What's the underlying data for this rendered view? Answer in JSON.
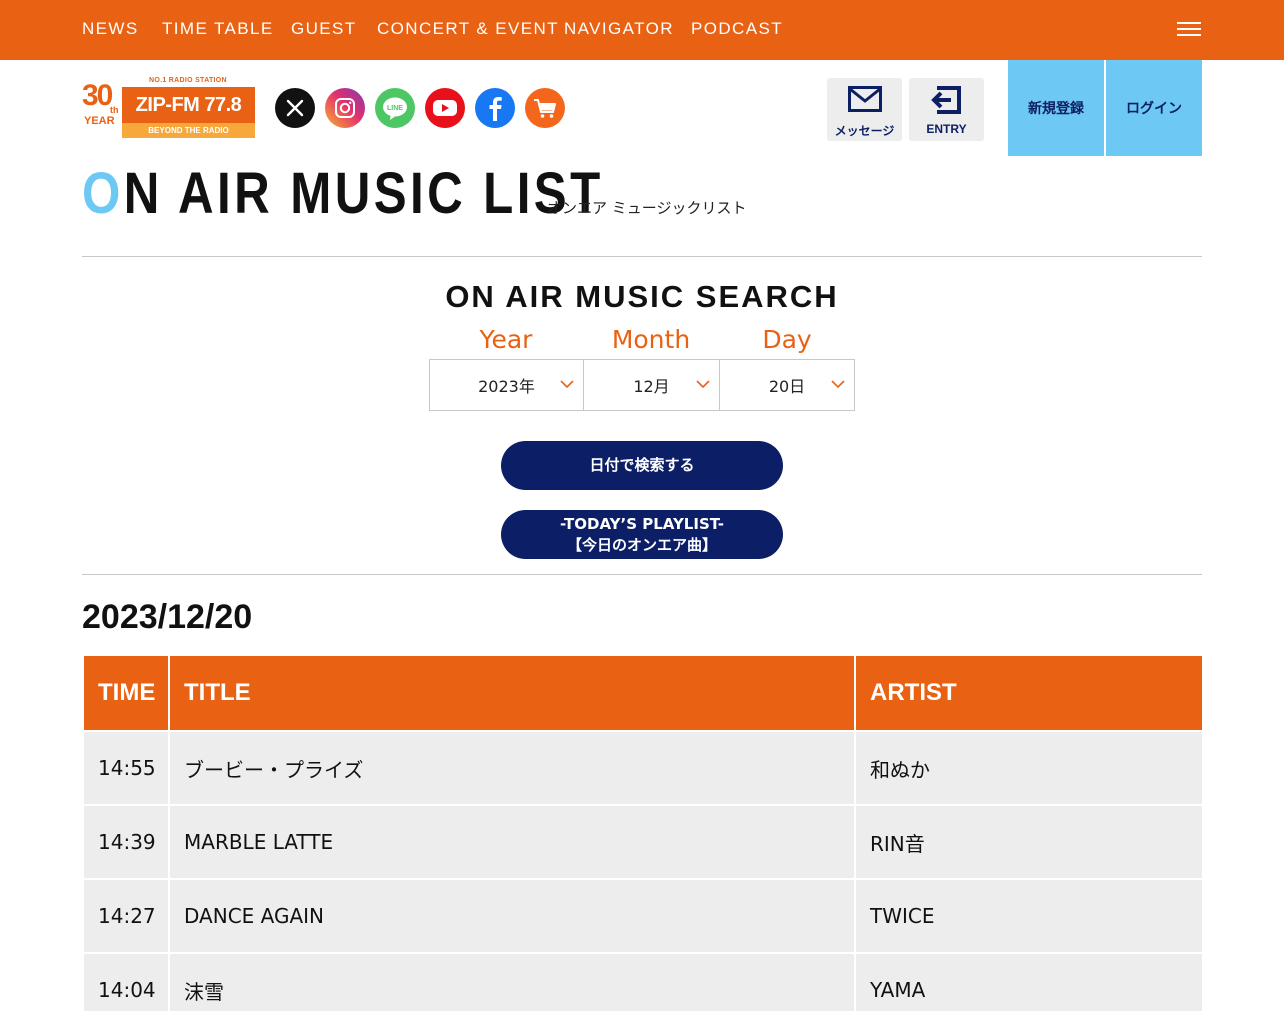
{
  "nav": {
    "items": [
      "NEWS",
      "TIME TABLE",
      "GUEST",
      "CONCERT & EVENT",
      "NAVIGATOR",
      "PODCAST"
    ],
    "menu_icon": "hamburger-menu-icon"
  },
  "logo": {
    "anniversary": "30",
    "anniversary_suffix": "th",
    "anniversary_year": "YEAR",
    "station_tag": "NO.1 RADIO STATION",
    "name": "ZIP-FM 77.8",
    "slogan": "BEYOND THE RADIO"
  },
  "social": [
    {
      "icon": "x-icon",
      "color": "#111111"
    },
    {
      "icon": "instagram-icon",
      "color": "#c13584"
    },
    {
      "icon": "line-icon",
      "color": "#4cc764"
    },
    {
      "icon": "youtube-icon",
      "color": "#e8101b"
    },
    {
      "icon": "facebook-icon",
      "color": "#1877f2"
    },
    {
      "icon": "cart-icon",
      "color": "#f4661b"
    }
  ],
  "header_buttons": {
    "message_label": "メッセージ",
    "entry_label": "ENTRY",
    "register_label": "新規登録",
    "login_label": "ログイン"
  },
  "page": {
    "title_first": "O",
    "title_rest": "N AIR MUSIC LIST",
    "subtitle": "オンエア ミュージックリスト"
  },
  "search": {
    "title": "ON AIR MUSIC SEARCH",
    "year_label": "Year",
    "month_label": "Month",
    "day_label": "Day",
    "year_value": "2023年",
    "month_value": "12月",
    "day_value": "20日",
    "search_button": "日付で検索する",
    "today_line1": "-TODAY’S PLAYLIST-",
    "today_line2": "【今日のオンエア曲】"
  },
  "playlist": {
    "date": "2023/12/20",
    "headers": {
      "time": "TIME",
      "title": "TITLE",
      "artist": "ARTIST"
    },
    "rows": [
      {
        "time": "14:55",
        "title": "ブービー・プライズ",
        "artist": "和ぬか"
      },
      {
        "time": "14:39",
        "title": "MARBLE LATTE",
        "artist": "RIN音"
      },
      {
        "time": "14:27",
        "title": "DANCE AGAIN",
        "artist": "TWICE"
      },
      {
        "time": "14:04",
        "title": "沫雪",
        "artist": "YAMA"
      }
    ]
  },
  "colors": {
    "brand_orange": "#e96213",
    "accent_blue": "#6ec8f4",
    "navy": "#0c1f66",
    "row_gray": "#ededed"
  }
}
